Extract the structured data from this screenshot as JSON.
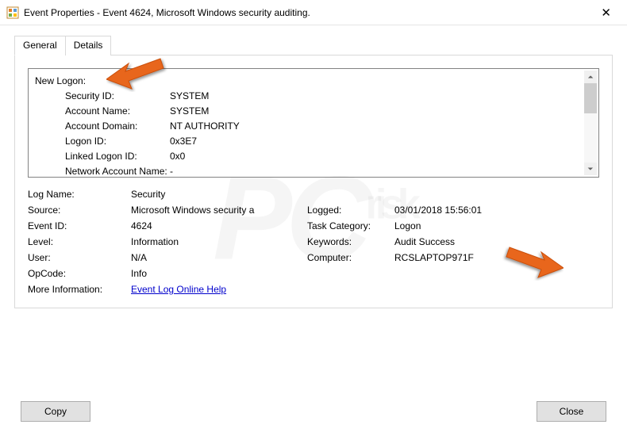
{
  "window": {
    "title": "Event Properties - Event 4624, Microsoft Windows security auditing.",
    "close_glyph": "✕"
  },
  "tabs": {
    "general": "General",
    "details": "Details"
  },
  "scroll": {
    "section": "New Logon:",
    "items": [
      {
        "k": "Security ID:",
        "v": "SYSTEM"
      },
      {
        "k": "Account Name:",
        "v": "SYSTEM"
      },
      {
        "k": "Account Domain:",
        "v": "NT AUTHORITY"
      },
      {
        "k": "Logon ID:",
        "v": "0x3E7"
      },
      {
        "k": "Linked Logon ID:",
        "v": "0x0"
      },
      {
        "k": "Network Account Name:",
        "v": "-"
      }
    ]
  },
  "props": {
    "log_name_l": "Log Name:",
    "log_name_v": "Security",
    "source_l": "Source:",
    "source_v": "Microsoft Windows security a",
    "logged_l": "Logged:",
    "logged_v": "03/01/2018 15:56:01",
    "event_id_l": "Event ID:",
    "event_id_v": "4624",
    "task_cat_l": "Task Category:",
    "task_cat_v": "Logon",
    "level_l": "Level:",
    "level_v": "Information",
    "keywords_l": "Keywords:",
    "keywords_v": "Audit Success",
    "user_l": "User:",
    "user_v": "N/A",
    "computer_l": "Computer:",
    "computer_v": "RCSLAPTOP971F",
    "opcode_l": "OpCode:",
    "opcode_v": "Info",
    "more_info_l": "More Information:",
    "more_info_link": "Event Log Online Help"
  },
  "buttons": {
    "copy": "Copy",
    "close": "Close",
    "up": "▲",
    "down": "▼"
  },
  "watermark": "PCrisk"
}
